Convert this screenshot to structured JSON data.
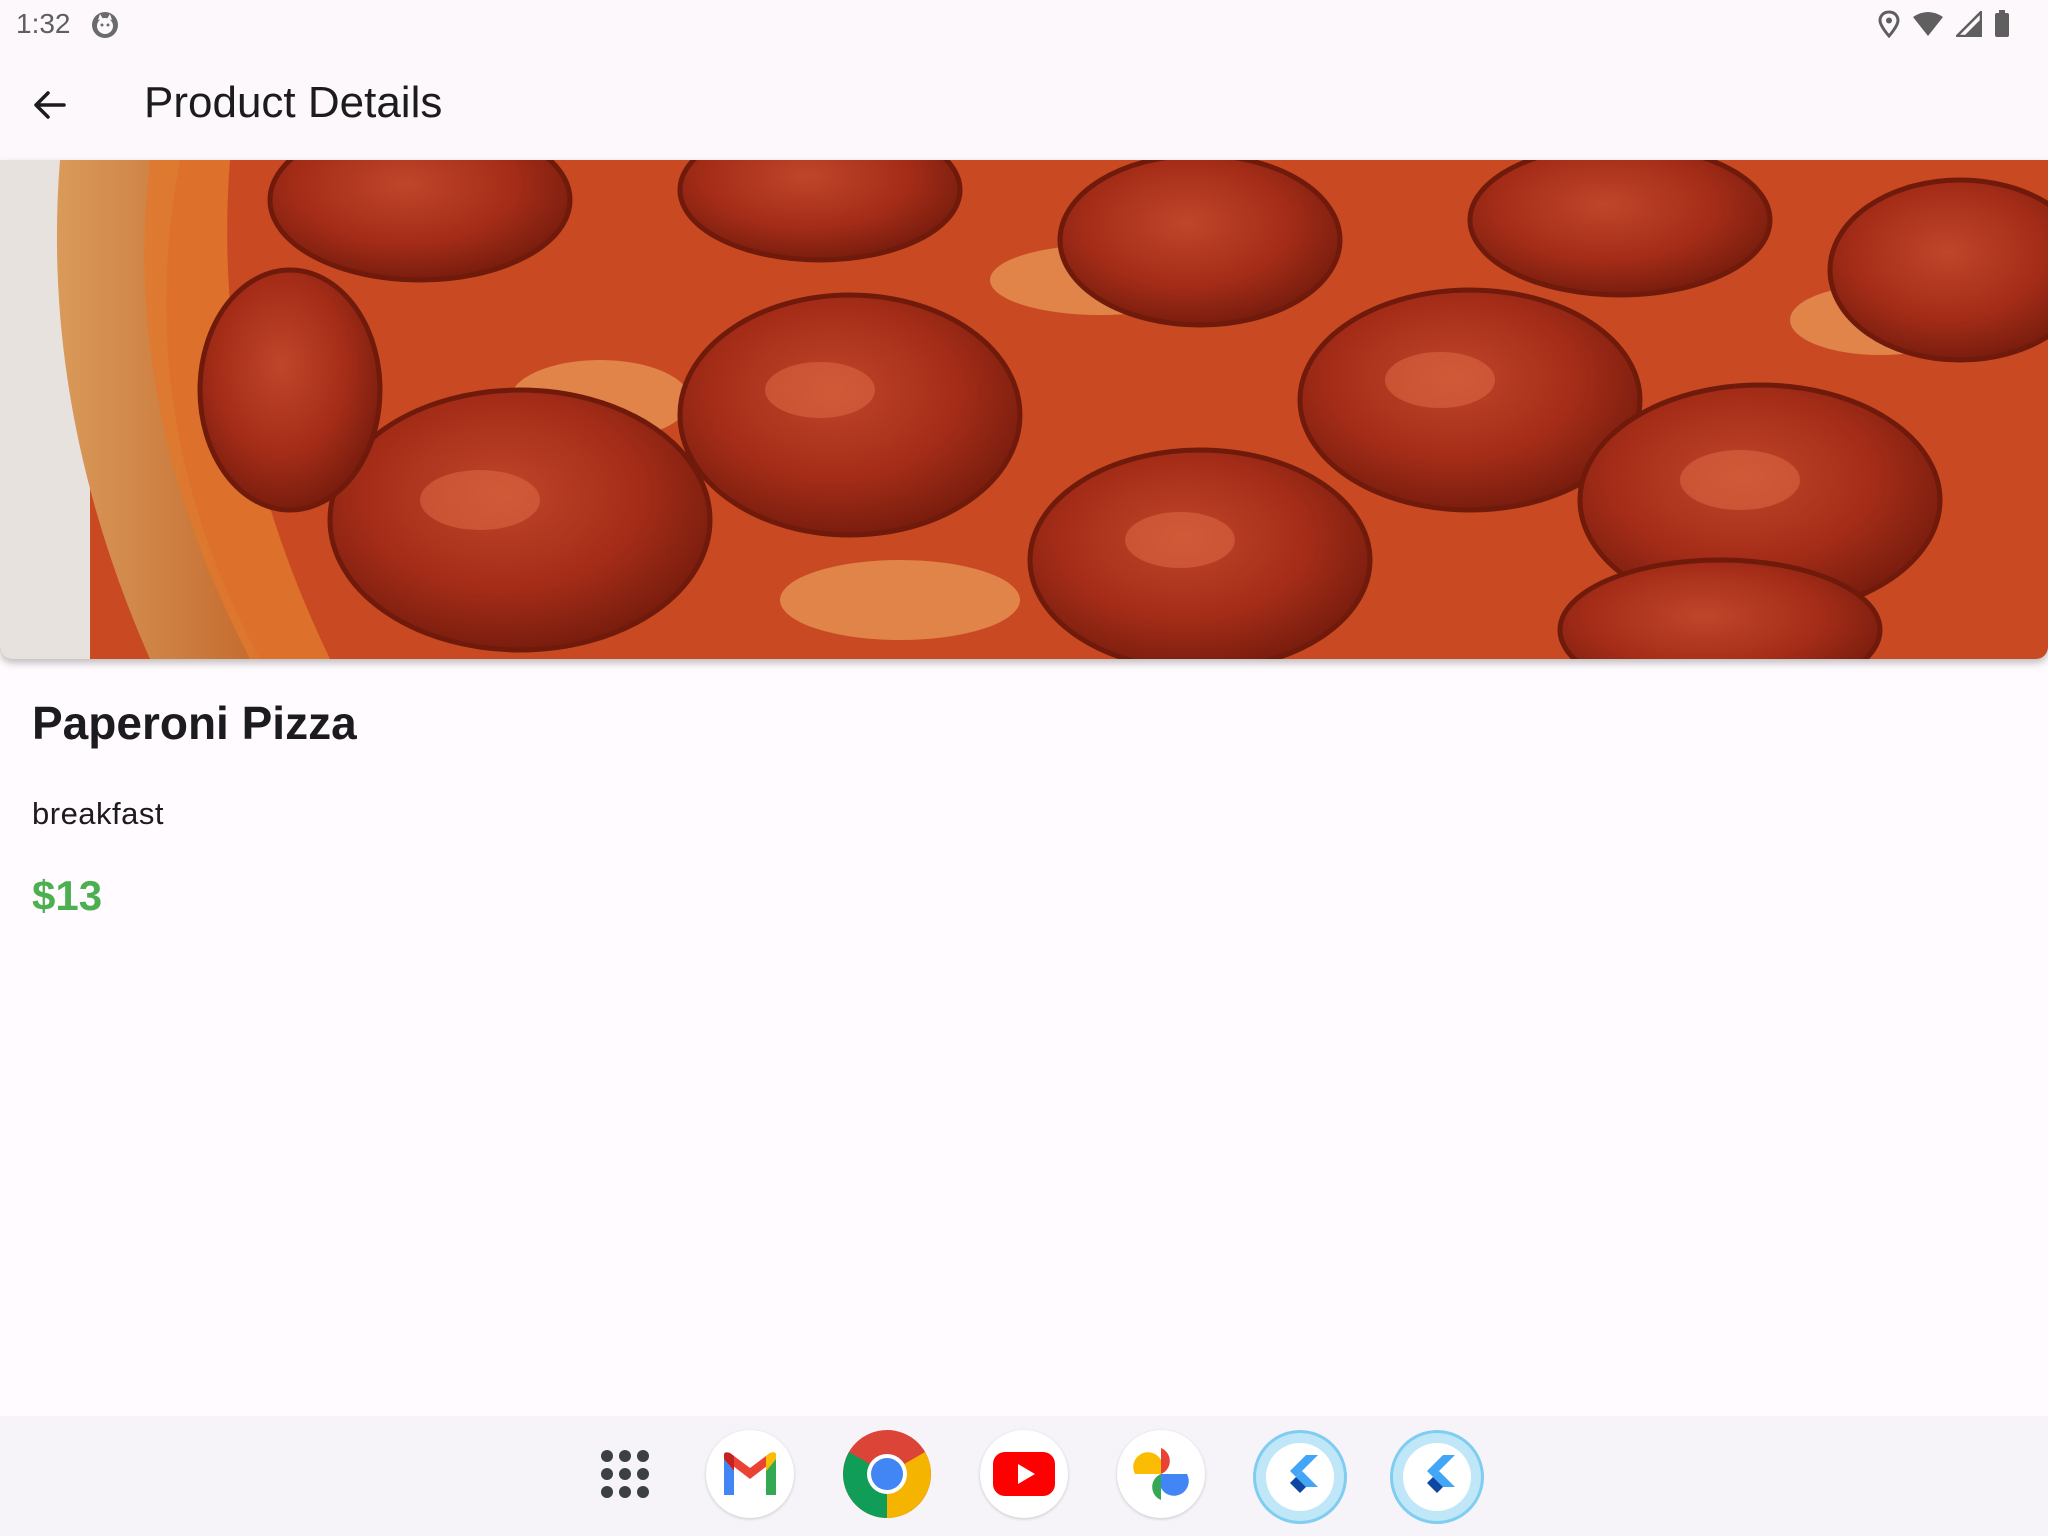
{
  "status_bar": {
    "time": "1:32",
    "icons": [
      "cat-notification-icon",
      "location-icon",
      "wifi-icon",
      "signal-icon",
      "battery-icon"
    ]
  },
  "app_bar": {
    "title": "Product Details",
    "back_icon": "arrow-back-icon"
  },
  "product": {
    "image_alt": "pepperoni-pizza-photo",
    "name": "Paperoni Pizza",
    "category": "breakfast",
    "price": "$13",
    "price_color": "#4caf50"
  },
  "dock": {
    "apps": [
      {
        "icon": "app-drawer-icon"
      },
      {
        "icon": "gmail-icon"
      },
      {
        "icon": "chrome-icon"
      },
      {
        "icon": "youtube-icon"
      },
      {
        "icon": "google-photos-icon"
      },
      {
        "icon": "flutter-app-icon"
      },
      {
        "icon": "flutter-app-icon"
      }
    ]
  }
}
